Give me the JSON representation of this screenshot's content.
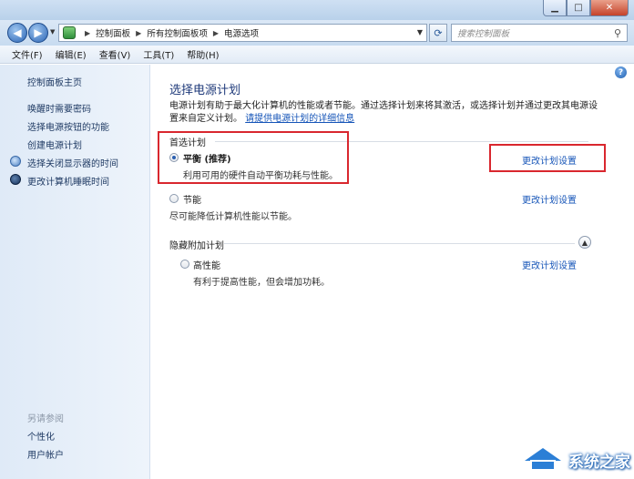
{
  "address": {
    "crumbs": [
      "控制面板",
      "所有控制面板项",
      "电源选项"
    ],
    "search_placeholder": "搜索控制面板"
  },
  "menu": [
    "文件(F)",
    "编辑(E)",
    "查看(V)",
    "工具(T)",
    "帮助(H)"
  ],
  "sidebar": {
    "home": "控制面板主页",
    "links": [
      "唤醒时需要密码",
      "选择电源按钮的功能",
      "创建电源计划",
      "选择关闭显示器的时间",
      "更改计算机睡眠时间"
    ],
    "see_also": "另请参阅",
    "see_also_links": [
      "个性化",
      "用户帐户"
    ]
  },
  "main": {
    "title": "选择电源计划",
    "desc": "电源计划有助于最大化计算机的性能或者节能。通过选择计划来将其激活，或选择计划并通过更改其电源设置来自定义计划。",
    "desc_link": "请提供电源计划的详细信息",
    "preferred_header": "首选计划",
    "hidden_header": "隐藏附加计划",
    "plans": [
      {
        "name": "平衡 (推荐)",
        "desc": "利用可用的硬件自动平衡功耗与性能。",
        "link": "更改计划设置",
        "selected": true
      },
      {
        "name": "节能",
        "desc": "尽可能降低计算机性能以节能。",
        "link": "更改计划设置",
        "selected": false
      },
      {
        "name": "高性能",
        "desc": "有利于提高性能，但会增加功耗。",
        "link": "更改计划设置",
        "selected": false
      }
    ]
  },
  "watermark": {
    "text": "系统之家"
  }
}
